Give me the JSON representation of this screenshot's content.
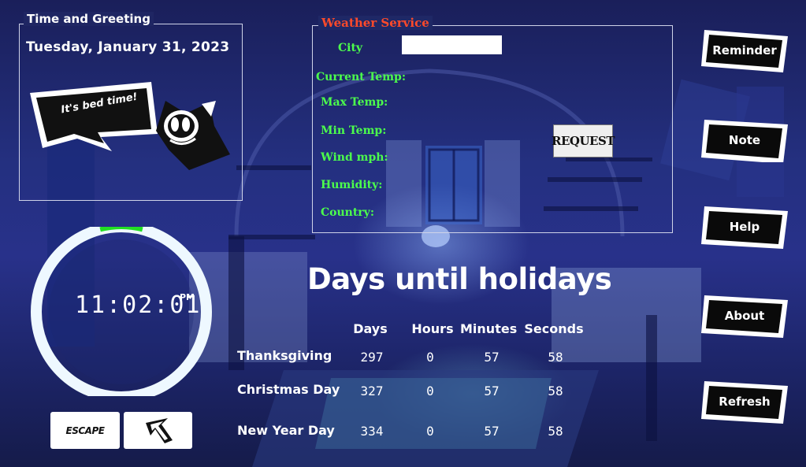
{
  "time_greeting": {
    "legend": "Time and Greeting",
    "date": "Tuesday, January 31, 2023",
    "bubble_text": "It's bed time!"
  },
  "weather": {
    "legend": "Weather Service",
    "labels": {
      "city": "City",
      "current_temp": "Current Temp:",
      "max_temp": "Max Temp:",
      "min_temp": "Min Temp:",
      "wind": "Wind mph:",
      "humidity": "Humidity:",
      "country": "Country:"
    },
    "city_value": "",
    "request_label": "REQUEST"
  },
  "clock": {
    "time": "11:02:01",
    "ampm": "PM",
    "ring_progress": 0.08
  },
  "bottom_buttons": {
    "escape_label": "ESCAPE"
  },
  "holidays": {
    "title": "Days until holidays",
    "headers": [
      "Days",
      "Hours",
      "Minutes",
      "Seconds"
    ],
    "rows": [
      {
        "name": "Thanksgiving",
        "days": "297",
        "hours": "0",
        "minutes": "57",
        "seconds": "58"
      },
      {
        "name": "Christmas Day",
        "days": "327",
        "hours": "0",
        "minutes": "57",
        "seconds": "58"
      },
      {
        "name": "New Year Day",
        "days": "334",
        "hours": "0",
        "minutes": "57",
        "seconds": "58"
      }
    ]
  },
  "side_buttons": {
    "reminder": "Reminder",
    "note": "Note",
    "help": "Help",
    "about": "About",
    "refresh": "Refresh"
  },
  "colors": {
    "weather_legend": "#ff4a2a",
    "weather_labels": "#4cff4c",
    "clock_ring": "#eef8ff",
    "clock_ring_progress": "#22e022"
  }
}
